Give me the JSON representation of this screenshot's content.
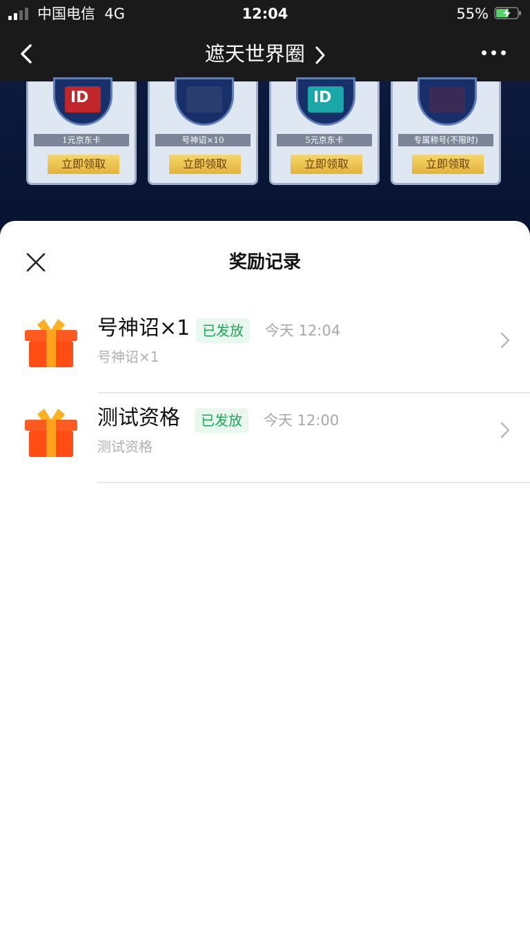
{
  "status_bar": {
    "carrier": "中国电信",
    "network": "4G",
    "time": "12:04",
    "battery_percent": "55%",
    "battery_level": 0.55,
    "signal_bars": 2,
    "signal_total": 4
  },
  "nav": {
    "title": "遮天世界圈"
  },
  "reward_cards": [
    {
      "name": "1元京东卡",
      "button": "立即领取",
      "thumb_text": "ID",
      "thumb_color": "#c0262a"
    },
    {
      "name": "号神诏×10",
      "button": "立即领取",
      "thumb_text": "",
      "thumb_color": "#2b3c6e"
    },
    {
      "name": "5元京东卡",
      "button": "立即领取",
      "thumb_text": "ID",
      "thumb_color": "#1aa7a8"
    },
    {
      "name": "专属称号(不限时)",
      "button": "立即领取",
      "thumb_text": "",
      "thumb_color": "#3a2a56"
    }
  ],
  "sheet": {
    "title": "奖励记录",
    "records": [
      {
        "title": "号神诏×1",
        "status": "已发放",
        "time": "今天 12:04",
        "subtitle": "号神诏×1"
      },
      {
        "title": "测试资格",
        "status": "已发放",
        "time": "今天 12:00",
        "subtitle": "测试资格"
      }
    ]
  },
  "colors": {
    "dark_bar": "#1a1a1a",
    "badge_bg": "#e9f8ee",
    "badge_text": "#1fa55a",
    "battery_green": "#4cd964"
  },
  "icons": [
    "back-arrow-icon",
    "chevron-right-icon",
    "more-dots-icon",
    "close-icon",
    "gift-icon",
    "battery-icon",
    "signal-icon"
  ]
}
